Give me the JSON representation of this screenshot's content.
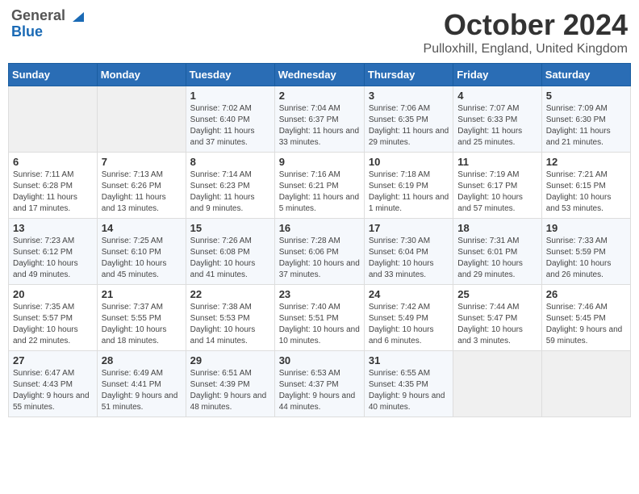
{
  "header": {
    "logo_general": "General",
    "logo_blue": "Blue",
    "title": "October 2024",
    "subtitle": "Pulloxhill, England, United Kingdom"
  },
  "weekdays": [
    "Sunday",
    "Monday",
    "Tuesday",
    "Wednesday",
    "Thursday",
    "Friday",
    "Saturday"
  ],
  "weeks": [
    [
      {
        "day": "",
        "empty": true
      },
      {
        "day": "",
        "empty": true
      },
      {
        "day": "1",
        "sunrise": "7:02 AM",
        "sunset": "6:40 PM",
        "daylight": "11 hours and 37 minutes."
      },
      {
        "day": "2",
        "sunrise": "7:04 AM",
        "sunset": "6:37 PM",
        "daylight": "11 hours and 33 minutes."
      },
      {
        "day": "3",
        "sunrise": "7:06 AM",
        "sunset": "6:35 PM",
        "daylight": "11 hours and 29 minutes."
      },
      {
        "day": "4",
        "sunrise": "7:07 AM",
        "sunset": "6:33 PM",
        "daylight": "11 hours and 25 minutes."
      },
      {
        "day": "5",
        "sunrise": "7:09 AM",
        "sunset": "6:30 PM",
        "daylight": "11 hours and 21 minutes."
      }
    ],
    [
      {
        "day": "6",
        "sunrise": "7:11 AM",
        "sunset": "6:28 PM",
        "daylight": "11 hours and 17 minutes."
      },
      {
        "day": "7",
        "sunrise": "7:13 AM",
        "sunset": "6:26 PM",
        "daylight": "11 hours and 13 minutes."
      },
      {
        "day": "8",
        "sunrise": "7:14 AM",
        "sunset": "6:23 PM",
        "daylight": "11 hours and 9 minutes."
      },
      {
        "day": "9",
        "sunrise": "7:16 AM",
        "sunset": "6:21 PM",
        "daylight": "11 hours and 5 minutes."
      },
      {
        "day": "10",
        "sunrise": "7:18 AM",
        "sunset": "6:19 PM",
        "daylight": "11 hours and 1 minute."
      },
      {
        "day": "11",
        "sunrise": "7:19 AM",
        "sunset": "6:17 PM",
        "daylight": "10 hours and 57 minutes."
      },
      {
        "day": "12",
        "sunrise": "7:21 AM",
        "sunset": "6:15 PM",
        "daylight": "10 hours and 53 minutes."
      }
    ],
    [
      {
        "day": "13",
        "sunrise": "7:23 AM",
        "sunset": "6:12 PM",
        "daylight": "10 hours and 49 minutes."
      },
      {
        "day": "14",
        "sunrise": "7:25 AM",
        "sunset": "6:10 PM",
        "daylight": "10 hours and 45 minutes."
      },
      {
        "day": "15",
        "sunrise": "7:26 AM",
        "sunset": "6:08 PM",
        "daylight": "10 hours and 41 minutes."
      },
      {
        "day": "16",
        "sunrise": "7:28 AM",
        "sunset": "6:06 PM",
        "daylight": "10 hours and 37 minutes."
      },
      {
        "day": "17",
        "sunrise": "7:30 AM",
        "sunset": "6:04 PM",
        "daylight": "10 hours and 33 minutes."
      },
      {
        "day": "18",
        "sunrise": "7:31 AM",
        "sunset": "6:01 PM",
        "daylight": "10 hours and 29 minutes."
      },
      {
        "day": "19",
        "sunrise": "7:33 AM",
        "sunset": "5:59 PM",
        "daylight": "10 hours and 26 minutes."
      }
    ],
    [
      {
        "day": "20",
        "sunrise": "7:35 AM",
        "sunset": "5:57 PM",
        "daylight": "10 hours and 22 minutes."
      },
      {
        "day": "21",
        "sunrise": "7:37 AM",
        "sunset": "5:55 PM",
        "daylight": "10 hours and 18 minutes."
      },
      {
        "day": "22",
        "sunrise": "7:38 AM",
        "sunset": "5:53 PM",
        "daylight": "10 hours and 14 minutes."
      },
      {
        "day": "23",
        "sunrise": "7:40 AM",
        "sunset": "5:51 PM",
        "daylight": "10 hours and 10 minutes."
      },
      {
        "day": "24",
        "sunrise": "7:42 AM",
        "sunset": "5:49 PM",
        "daylight": "10 hours and 6 minutes."
      },
      {
        "day": "25",
        "sunrise": "7:44 AM",
        "sunset": "5:47 PM",
        "daylight": "10 hours and 3 minutes."
      },
      {
        "day": "26",
        "sunrise": "7:46 AM",
        "sunset": "5:45 PM",
        "daylight": "9 hours and 59 minutes."
      }
    ],
    [
      {
        "day": "27",
        "sunrise": "6:47 AM",
        "sunset": "4:43 PM",
        "daylight": "9 hours and 55 minutes."
      },
      {
        "day": "28",
        "sunrise": "6:49 AM",
        "sunset": "4:41 PM",
        "daylight": "9 hours and 51 minutes."
      },
      {
        "day": "29",
        "sunrise": "6:51 AM",
        "sunset": "4:39 PM",
        "daylight": "9 hours and 48 minutes."
      },
      {
        "day": "30",
        "sunrise": "6:53 AM",
        "sunset": "4:37 PM",
        "daylight": "9 hours and 44 minutes."
      },
      {
        "day": "31",
        "sunrise": "6:55 AM",
        "sunset": "4:35 PM",
        "daylight": "9 hours and 40 minutes."
      },
      {
        "day": "",
        "empty": true
      },
      {
        "day": "",
        "empty": true
      }
    ]
  ],
  "labels": {
    "sunrise_prefix": "Sunrise: ",
    "sunset_prefix": "Sunset: ",
    "daylight_prefix": "Daylight: "
  }
}
